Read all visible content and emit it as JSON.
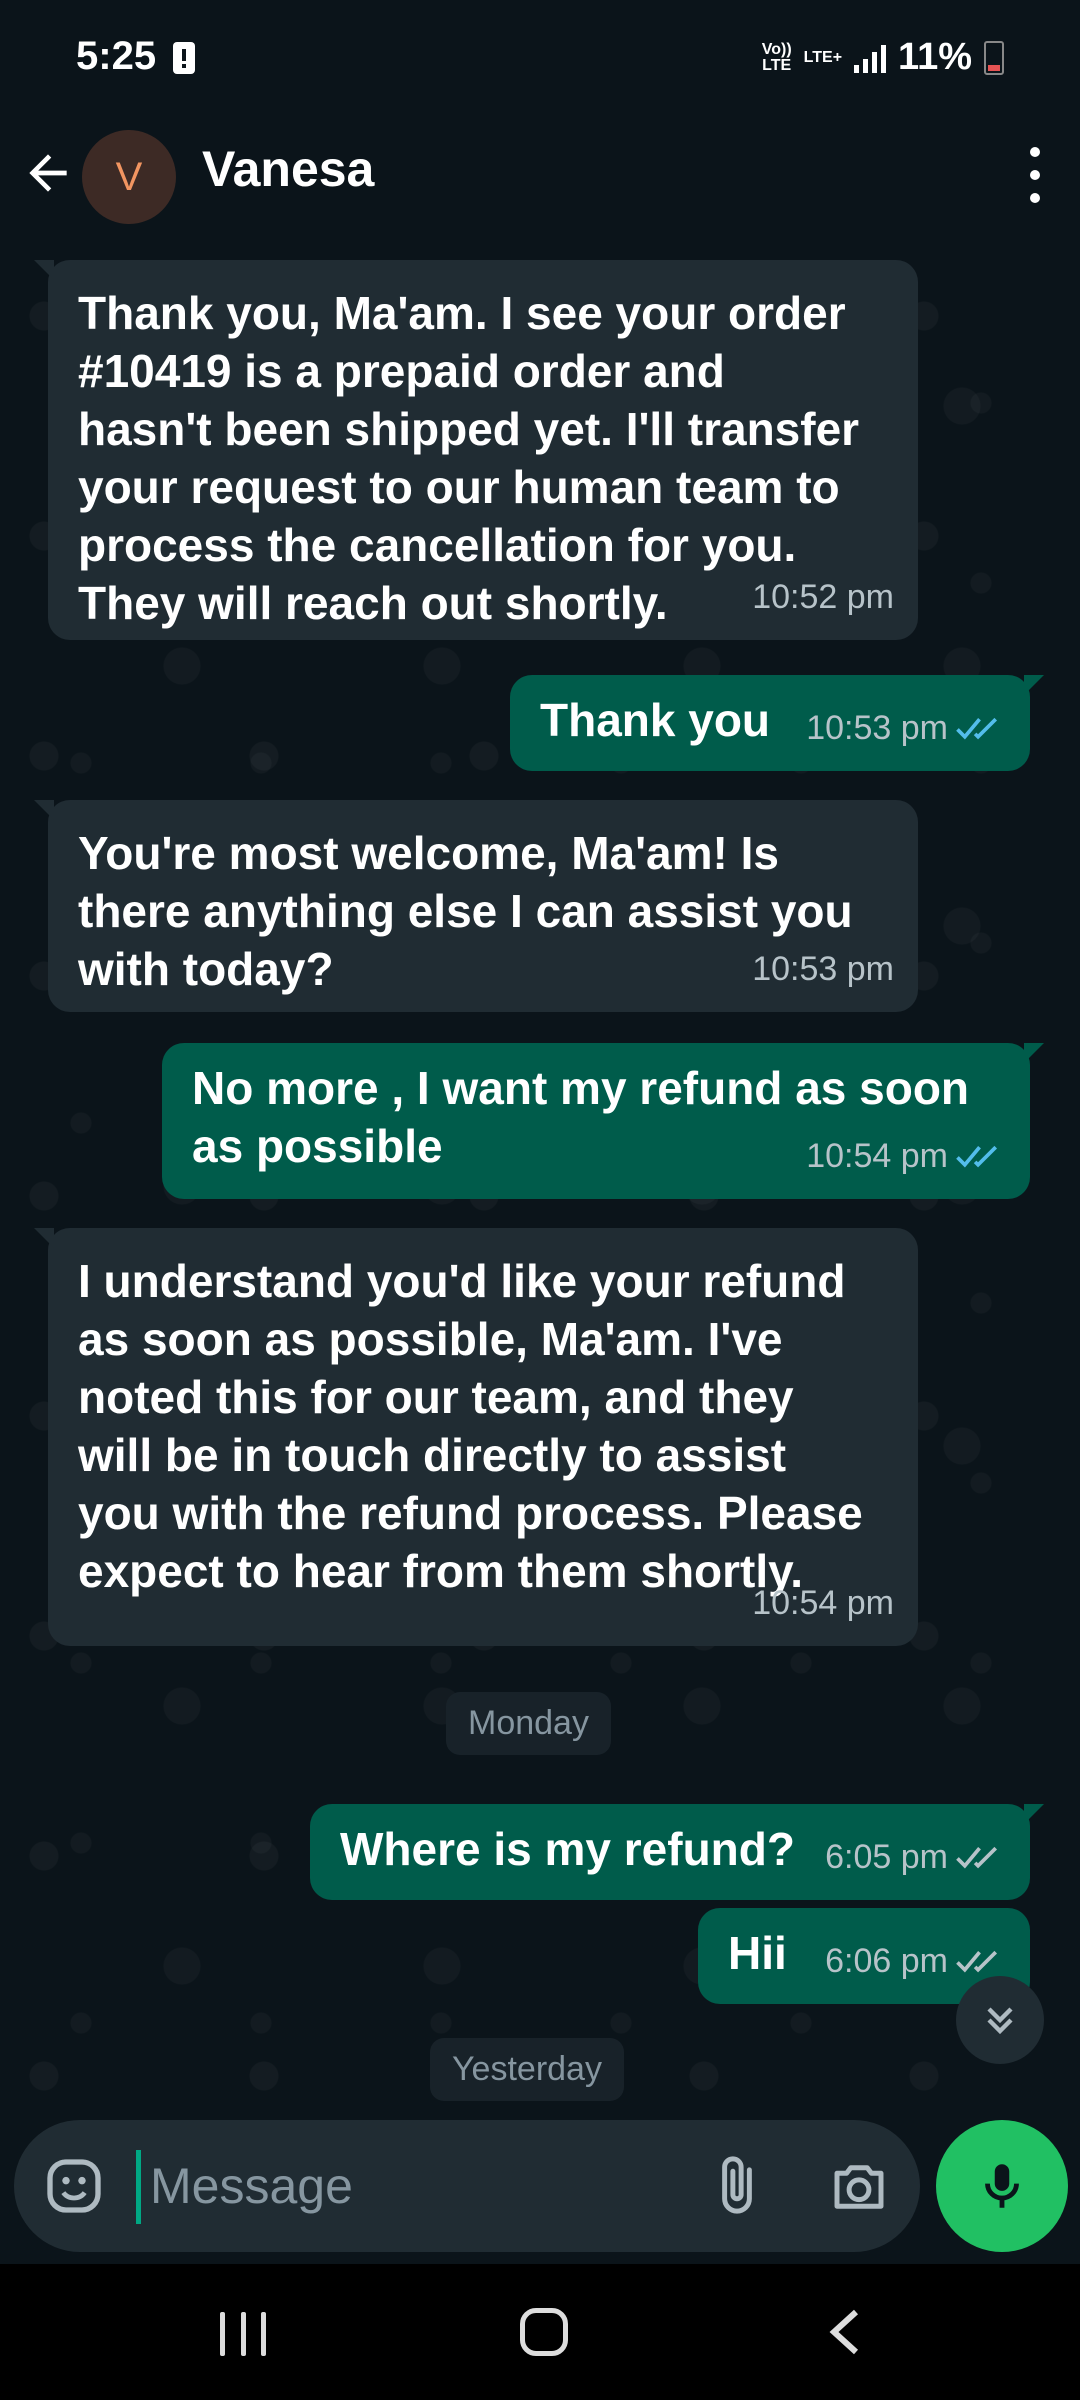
{
  "status_bar": {
    "time": "5:25",
    "network_label": "Vo))\nLTE",
    "lte_label": "LTE+",
    "battery": "11%"
  },
  "header": {
    "avatar_initial": "V",
    "contact_name": "Vanesa"
  },
  "messages": [
    {
      "direction": "in",
      "text": "Thank you, Ma'am. I see your order\n#10419 is a prepaid order and\nhasn't been shipped yet. I'll transfer\nyour request to our human team to\nprocess the cancellation for you.\nThey will reach out shortly.",
      "time": "10:52 pm"
    },
    {
      "direction": "out",
      "text": "Thank you",
      "time": "10:53 pm",
      "status": "read"
    },
    {
      "direction": "in",
      "text": "You're most welcome, Ma'am! Is\nthere anything else I can assist you\nwith today?",
      "time": "10:53 pm"
    },
    {
      "direction": "out",
      "text": "No more , I want my refund as soon\nas possible",
      "time": "10:54 pm",
      "status": "read"
    },
    {
      "direction": "in",
      "text": "I understand you'd like your refund\nas soon as possible, Ma'am. I've\nnoted this for our team, and they\nwill be in touch directly to assist\nyou with the refund process. Please\nexpect to hear from them shortly.",
      "time": "10:54 pm"
    },
    {
      "direction": "out",
      "text": "Where is my refund?",
      "time": "6:05 pm",
      "status": "delivered"
    },
    {
      "direction": "out",
      "text": "Hii",
      "time": "6:06 pm",
      "status": "delivered"
    }
  ],
  "day_chips": [
    "Monday",
    "Yesterday"
  ],
  "composer": {
    "placeholder": "Message"
  },
  "colors": {
    "background": "#0b141a",
    "incoming_bubble": "#202c33",
    "outgoing_bubble": "#005c4b",
    "accent": "#21c063",
    "read_tick": "#53bdeb",
    "delivered_tick": "#b7c3c9"
  },
  "icons": [
    "back-arrow-icon",
    "more-vert-icon",
    "emoji-icon",
    "attach-icon",
    "camera-icon",
    "mic-icon",
    "scroll-down-icon",
    "double-check-icon"
  ]
}
